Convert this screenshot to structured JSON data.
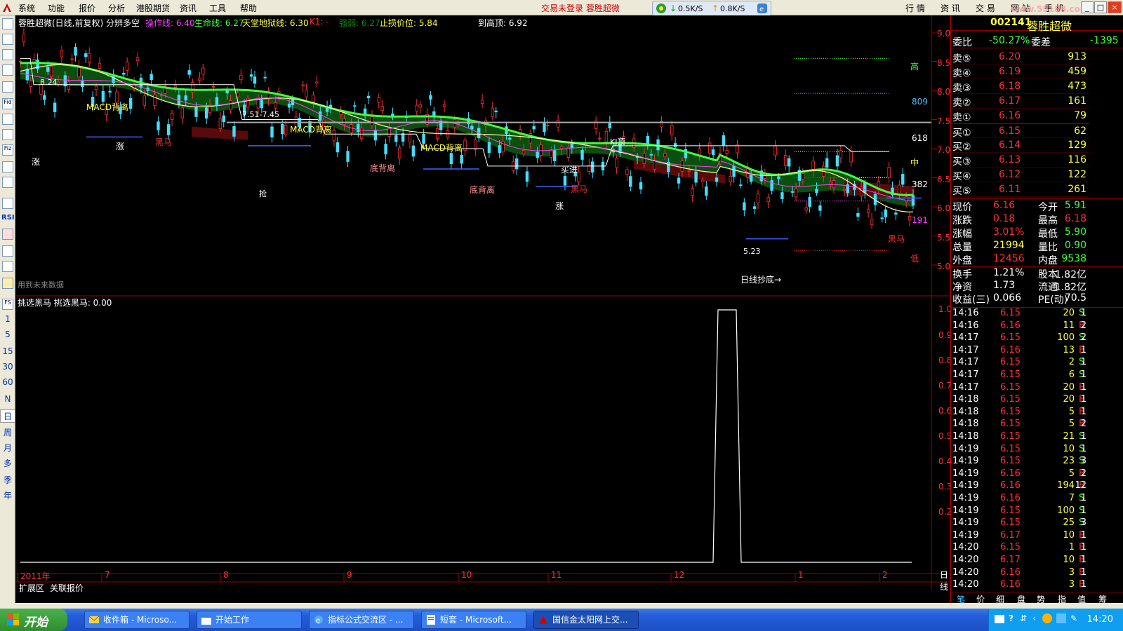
{
  "menubar": {
    "items": [
      "系统",
      "功能",
      "报价",
      "分析",
      "港股期货",
      "资讯",
      "工具",
      "帮助"
    ],
    "login_warning": "交易未登录  蓉胜超微",
    "net_down": "0.5K/S",
    "net_up": "0.8K/S",
    "right_tabs": [
      "行 情",
      "资 讯",
      "交 易",
      "网 站",
      "手 机"
    ],
    "watermark": "www.55188.com"
  },
  "chart": {
    "title": "蓉胜超微(日线,前复权) 分辨多空",
    "indicators": [
      {
        "label": "操作线: 6.40",
        "color": "#ff3cff"
      },
      {
        "label": "生命线: 6.27",
        "color": "#40ff40"
      },
      {
        "label": "天堂地狱线: 6.30",
        "color": "#ffff40"
      },
      {
        "label": "K1: -",
        "color": "#ff3030"
      },
      {
        "label": "强弱: 6.27",
        "color": "#006000"
      },
      {
        "label": "止损价位: 5.84",
        "color": "#ffff40"
      },
      {
        "label": "到高顶: 6.92",
        "color": "#ffffff"
      }
    ],
    "price_axis": [
      "9.00",
      "8.50",
      "8.00",
      "7.50",
      "7.00",
      "6.50",
      "6.00",
      "5.50",
      "5.00"
    ],
    "fib_labels": [
      "高",
      "809",
      "618",
      "中",
      "382",
      "191",
      "低"
    ],
    "annotations": {
      "peak_price": "8.24",
      "trough_price": "5.23",
      "range_label": "7.51-7.45",
      "macd1": "MACD背离",
      "macd2": "MACD背离",
      "macd3": "MACD背离",
      "bottom_div1": "底背离",
      "bottom_div2": "底背离",
      "black_horse1": "黑马",
      "black_horse2": "黑马",
      "black_horse3": "黑马",
      "kd": "KJ顶",
      "buy_in": "买进",
      "day_bottom": "日线抄底→",
      "future_data": "用到未来数据",
      "rise1": "涨",
      "rise2": "涨",
      "rise3": "涨",
      "grab": "抢"
    },
    "sub_title": "挑选黑马  挑选黑马: 0.00",
    "sub_axis": [
      "1.00",
      "0.90",
      "0.80",
      "0.70",
      "0.60",
      "0.50",
      "0.40",
      "0.30",
      "0.20"
    ],
    "x_axis": [
      "2011年",
      "7",
      "8",
      "9",
      "10",
      "11",
      "12",
      "1",
      "2"
    ],
    "period_label": "日线",
    "bottom_tabs": [
      "扩展区",
      "关联报价"
    ]
  },
  "toolbar": {
    "periods": [
      "1",
      "5",
      "15",
      "30",
      "60",
      "N",
      "日",
      "周",
      "月",
      "多",
      "季",
      "年"
    ],
    "icon_labels": [
      "Fid",
      "Fiz",
      "RSI",
      "FS"
    ]
  },
  "stock": {
    "code": "002141",
    "name": "蓉胜超微",
    "wei_bi_label": "委比",
    "wei_bi": "-50.27%",
    "wei_cha_label": "委差",
    "wei_cha": "-1395",
    "sells": [
      {
        "label": "卖⑤",
        "price": "6.20",
        "vol": "913"
      },
      {
        "label": "卖④",
        "price": "6.19",
        "vol": "459"
      },
      {
        "label": "卖③",
        "price": "6.18",
        "vol": "473"
      },
      {
        "label": "卖②",
        "price": "6.17",
        "vol": "161"
      },
      {
        "label": "卖①",
        "price": "6.16",
        "vol": "79"
      }
    ],
    "buys": [
      {
        "label": "买①",
        "price": "6.15",
        "vol": "62"
      },
      {
        "label": "买②",
        "price": "6.14",
        "vol": "129"
      },
      {
        "label": "买③",
        "price": "6.13",
        "vol": "116"
      },
      {
        "label": "买④",
        "price": "6.12",
        "vol": "122"
      },
      {
        "label": "买⑤",
        "price": "6.11",
        "vol": "261"
      }
    ],
    "stats": [
      {
        "l1": "现价",
        "v1": "6.16",
        "c1": "#ff3030",
        "l2": "今开",
        "v2": "5.91",
        "c2": "#40ff40"
      },
      {
        "l1": "涨跌",
        "v1": "0.18",
        "c1": "#ff3030",
        "l2": "最高",
        "v2": "6.18",
        "c2": "#ff3030"
      },
      {
        "l1": "涨幅",
        "v1": "3.01%",
        "c1": "#ff3030",
        "l2": "最低",
        "v2": "5.90",
        "c2": "#40ff40"
      },
      {
        "l1": "总量",
        "v1": "21994",
        "c1": "#ffff40",
        "l2": "量比",
        "v2": "0.90",
        "c2": "#40ff40"
      },
      {
        "l1": "外盘",
        "v1": "12456",
        "c1": "#ff3030",
        "l2": "内盘",
        "v2": "9538",
        "c2": "#40ff40"
      }
    ],
    "stats2": [
      {
        "l1": "换手",
        "v1": "1.21%",
        "l2": "股本",
        "v2": "1.82亿"
      },
      {
        "l1": "净资",
        "v1": "1.73",
        "l2": "流通",
        "v2": "1.82亿"
      },
      {
        "l1": "收益(三)",
        "v1": "0.066",
        "l2": "PE(动)",
        "v2": "70.5"
      }
    ],
    "ticks": [
      {
        "t": "14:16",
        "p": "6.15",
        "v": "20",
        "s": "S",
        "n": "1"
      },
      {
        "t": "14:16",
        "p": "6.16",
        "v": "11",
        "s": "B",
        "n": "2"
      },
      {
        "t": "14:17",
        "p": "6.15",
        "v": "100",
        "s": "S",
        "n": "2"
      },
      {
        "t": "14:17",
        "p": "6.16",
        "v": "13",
        "s": "B",
        "n": "1"
      },
      {
        "t": "14:17",
        "p": "6.15",
        "v": "2",
        "s": "S",
        "n": "1"
      },
      {
        "t": "14:17",
        "p": "6.15",
        "v": "6",
        "s": "S",
        "n": "1"
      },
      {
        "t": "14:17",
        "p": "6.15",
        "v": "20",
        "s": "B",
        "n": "1"
      },
      {
        "t": "14:18",
        "p": "6.15",
        "v": "20",
        "s": "B",
        "n": "1"
      },
      {
        "t": "14:18",
        "p": "6.15",
        "v": "5",
        "s": "B",
        "n": "1"
      },
      {
        "t": "14:18",
        "p": "6.15",
        "v": "5",
        "s": "B",
        "n": "2"
      },
      {
        "t": "14:18",
        "p": "6.15",
        "v": "21",
        "s": "S",
        "n": "1"
      },
      {
        "t": "14:19",
        "p": "6.15",
        "v": "10",
        "s": "S",
        "n": "1"
      },
      {
        "t": "14:19",
        "p": "6.15",
        "v": "23",
        "s": "S",
        "n": "3"
      },
      {
        "t": "14:19",
        "p": "6.16",
        "v": "5",
        "s": "B",
        "n": "2"
      },
      {
        "t": "14:19",
        "p": "6.16",
        "v": "194",
        "s": "B",
        "n": "12"
      },
      {
        "t": "14:19",
        "p": "6.16",
        "v": "7",
        "s": "S",
        "n": "1"
      },
      {
        "t": "14:19",
        "p": "6.15",
        "v": "100",
        "s": "S",
        "n": "1"
      },
      {
        "t": "14:19",
        "p": "6.15",
        "v": "25",
        "s": "S",
        "n": "3"
      },
      {
        "t": "14:19",
        "p": "6.17",
        "v": "10",
        "s": "B",
        "n": "1"
      },
      {
        "t": "14:20",
        "p": "6.15",
        "v": "1",
        "s": "B",
        "n": "1"
      },
      {
        "t": "14:20",
        "p": "6.17",
        "v": "10",
        "s": "B",
        "n": "1"
      },
      {
        "t": "14:20",
        "p": "6.16",
        "v": "3",
        "s": "B",
        "n": "1"
      },
      {
        "t": "14:20",
        "p": "6.16",
        "v": "3",
        "s": "B",
        "n": "1"
      }
    ],
    "bottom_tabs": [
      "笔",
      "价",
      "细",
      "盘",
      "势",
      "指",
      "值",
      "筹"
    ]
  },
  "taskbar": {
    "start": "开始",
    "tasks": [
      "收件箱 - Microso...",
      "开始工作",
      "指标公式交流区 - ...",
      "短套 - Microsoft...",
      "国信金太阳网上交..."
    ],
    "clock": "14:20"
  }
}
